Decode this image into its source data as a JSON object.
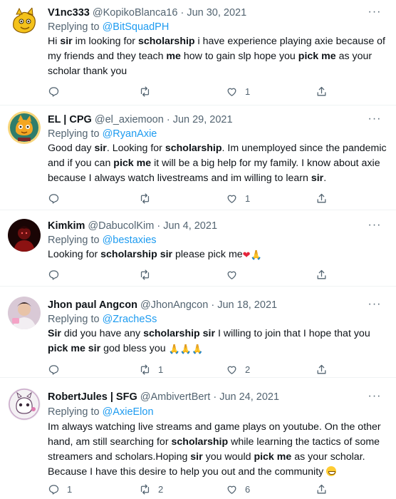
{
  "tweets": [
    {
      "name": "V1nc333",
      "handle": "@KopikoBlanca16",
      "sep": "·",
      "date": "Jun 30, 2021",
      "replying_prefix": "Replying to ",
      "replying_to": "@BitSquadPH",
      "lines": [
        [
          [
            "Hi ",
            false
          ],
          [
            "sir",
            true
          ],
          [
            " im looking for ",
            false
          ],
          [
            "scholarship",
            true
          ],
          [
            " i have experience playing axie because of",
            false
          ]
        ],
        [
          [
            "my friends and they teach ",
            false
          ],
          [
            "me",
            true
          ],
          [
            " how to gain slp hope you ",
            false
          ],
          [
            "pick me",
            true
          ],
          [
            " as your",
            false
          ]
        ],
        [
          [
            "scholar thank you",
            false
          ]
        ]
      ],
      "reply_count": "",
      "retweet_count": "",
      "like_count": "1",
      "avatar": "yellow-cartoon-character"
    },
    {
      "name": "EL | CPG",
      "handle": "@el_axiemoon",
      "sep": "·",
      "date": "Jun 29, 2021",
      "replying_prefix": "Replying to ",
      "replying_to": "@RyanAxie",
      "lines": [
        [
          [
            "Good day ",
            false
          ],
          [
            "sir",
            true
          ],
          [
            ". Looking for ",
            false
          ],
          [
            "scholarship",
            true
          ],
          [
            ". Im unemployed since the pandemic",
            false
          ]
        ],
        [
          [
            "and if you can ",
            false
          ],
          [
            "pick me",
            true
          ],
          [
            " it will be a big help for my family. I know about axie",
            false
          ]
        ],
        [
          [
            "because I always watch livestreams and im willing to learn ",
            false
          ],
          [
            "sir",
            true
          ],
          [
            ".",
            false
          ]
        ]
      ],
      "reply_count": "",
      "retweet_count": "",
      "like_count": "1",
      "avatar": "axie-badge"
    },
    {
      "name": "Kimkim",
      "handle": "@DabucolKim",
      "sep": "·",
      "date": "Jun 4, 2021",
      "replying_prefix": "Replying to ",
      "replying_to": "@bestaxies",
      "lines": [
        [
          [
            "Looking for ",
            false
          ],
          [
            "scholarship sir",
            true
          ],
          [
            " please pick me",
            false
          ]
        ]
      ],
      "trailing_emoji": [
        "❤",
        "🙏"
      ],
      "reply_count": "",
      "retweet_count": "",
      "like_count": "",
      "avatar": "dark-red-figure"
    },
    {
      "name": "Jhon paul Angcon",
      "handle": "@JhonAngcon",
      "sep": "·",
      "date": "Jun 18, 2021",
      "replying_prefix": "Replying to ",
      "replying_to": "@ZracheSs",
      "lines": [
        [
          [
            "Sir",
            true
          ],
          [
            " did you have any ",
            false
          ],
          [
            "scholarship sir",
            true
          ],
          [
            " I willing to join that I hope that you",
            false
          ]
        ],
        [
          [
            "pick me sir",
            true
          ],
          [
            " god bless you ",
            false
          ]
        ]
      ],
      "trailing_emoji": [
        "🙏🙏🙏"
      ],
      "reply_count": "",
      "retweet_count": "1",
      "like_count": "2",
      "avatar": "person-photo"
    },
    {
      "name": "RobertJules | SFG",
      "handle": "@AmbivertBert",
      "sep": "·",
      "date": "Jun 24, 2021",
      "replying_prefix": "Replying to ",
      "replying_to": "@AxieElon",
      "lines": [
        [
          [
            "Im always watching live streams and game plays on youtube. On the other",
            false
          ]
        ],
        [
          [
            "hand, am still searching for ",
            false
          ],
          [
            "scholarship",
            true
          ],
          [
            " while learning the tactics of some",
            false
          ]
        ],
        [
          [
            "streamers and scholars.Hoping ",
            false
          ],
          [
            "sir",
            true
          ],
          [
            " you would ",
            false
          ],
          [
            "pick me",
            true
          ],
          [
            " as your scholar.",
            false
          ]
        ],
        [
          [
            "Because I have this desire to help you out and the community ",
            false
          ]
        ]
      ],
      "trailing_emoji": [
        "😁"
      ],
      "reply_count": "1",
      "retweet_count": "2",
      "like_count": "6",
      "avatar": "white-axie-badge"
    }
  ],
  "colors": {
    "link": "#1d9bf0",
    "muted": "#536471",
    "text": "#0f1419",
    "divider": "#eff3f4"
  },
  "icons": [
    "reply-icon",
    "retweet-icon",
    "like-icon",
    "share-icon",
    "more-icon"
  ]
}
